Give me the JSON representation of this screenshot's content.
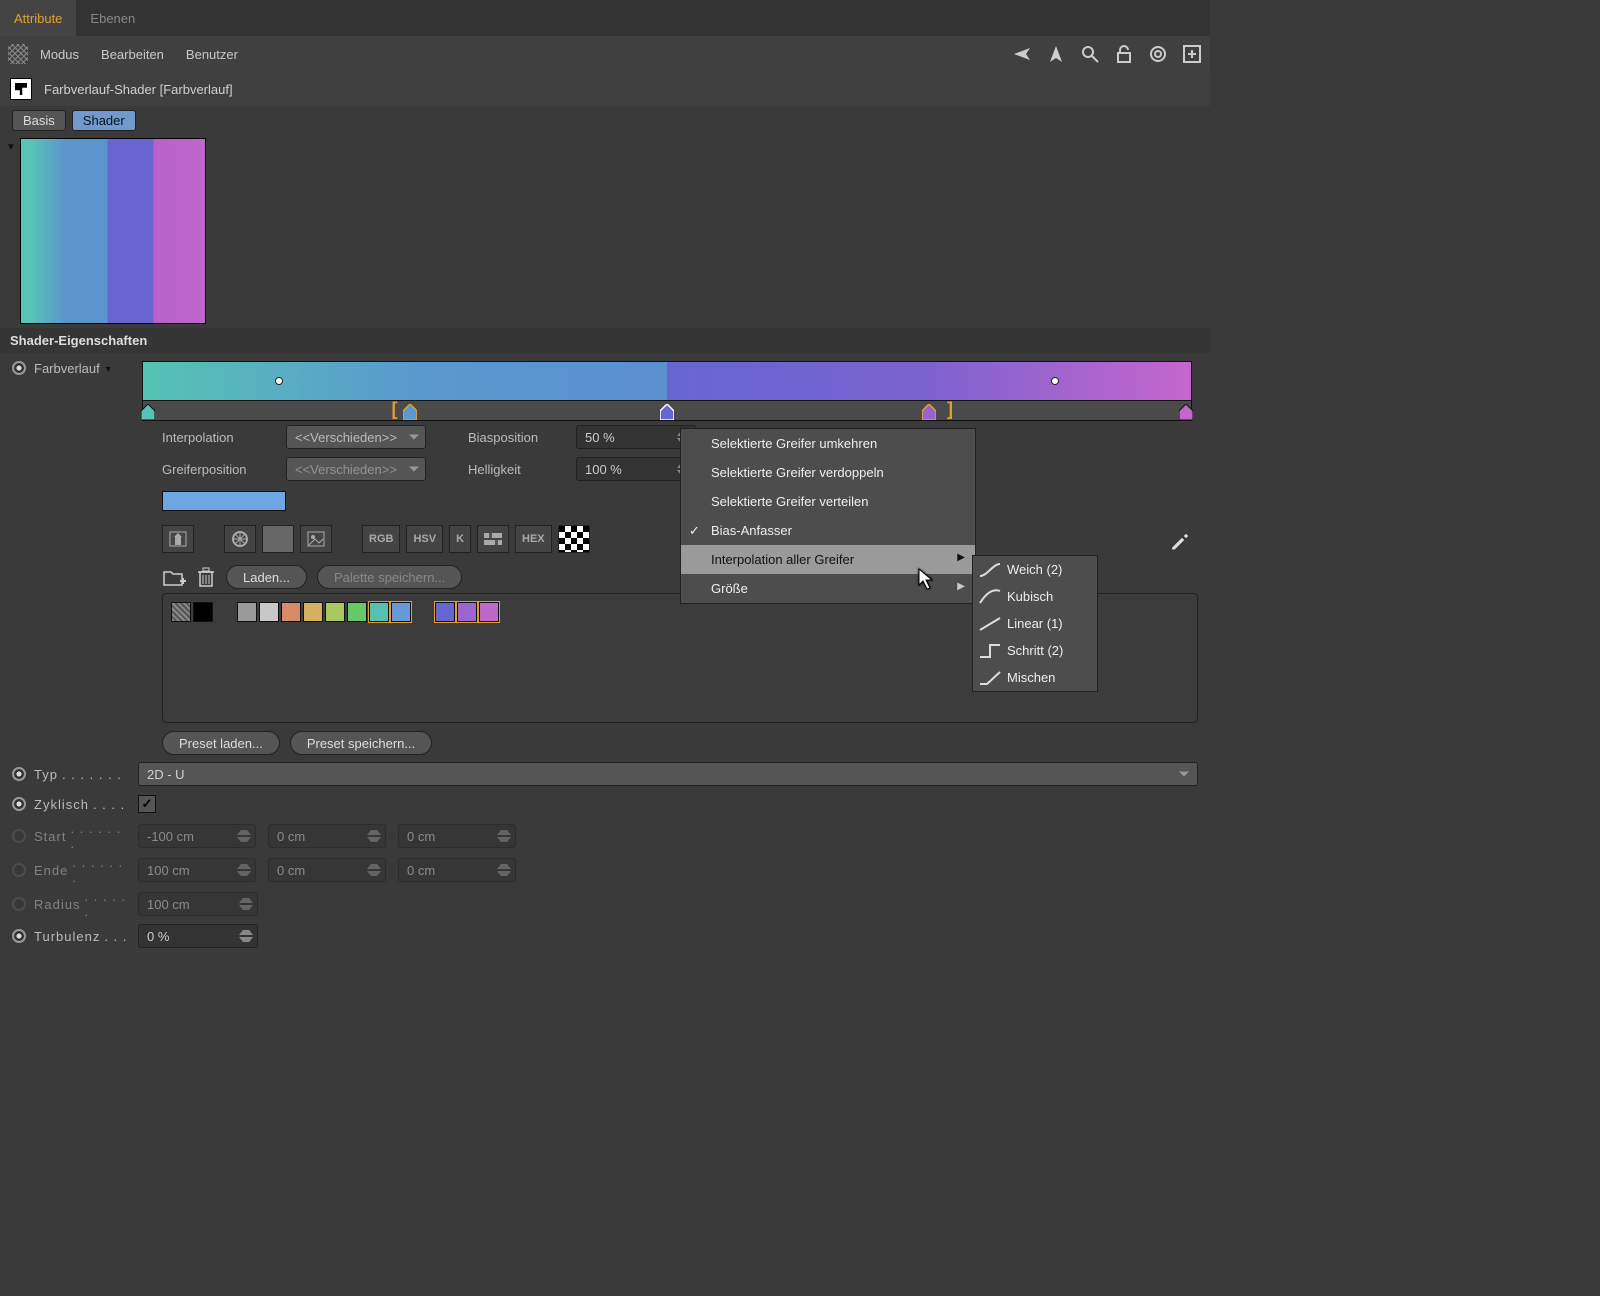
{
  "topTabs": {
    "attribute": "Attribute",
    "ebenen": "Ebenen"
  },
  "menuBar": {
    "modus": "Modus",
    "bearbeiten": "Bearbeiten",
    "benutzer": "Benutzer"
  },
  "title": "Farbverlauf-Shader [Farbverlauf]",
  "subTabs": {
    "basis": "Basis",
    "shader": "Shader"
  },
  "sectionHead": "Shader-Eigenschaften",
  "gradientLabel": "Farbverlauf",
  "interp": {
    "label": "Interpolation",
    "value": "<<Verschieden>>"
  },
  "handlePos": {
    "label": "Greiferposition",
    "value": "<<Verschieden>>"
  },
  "biasPos": {
    "label": "Biasposition",
    "value": "50 %"
  },
  "brightness": {
    "label": "Helligkeit",
    "value": "100 %"
  },
  "iconLabels": {
    "rgb": "RGB",
    "hsv": "HSV",
    "k": "K",
    "hex": "HEX"
  },
  "loadBtn": "Laden...",
  "savePaletteBtn": "Palette speichern...",
  "presetLoad": "Preset laden...",
  "presetSave": "Preset speichern...",
  "typ": {
    "label": "Typ",
    "value": "2D - U"
  },
  "zyklisch": {
    "label": "Zyklisch",
    "value": true
  },
  "start": {
    "label": "Start",
    "x": "-100 cm",
    "y": "0 cm",
    "z": "0 cm"
  },
  "ende": {
    "label": "Ende",
    "x": "100 cm",
    "y": "0 cm",
    "z": "0 cm"
  },
  "radius": {
    "label": "Radius",
    "value": "100 cm"
  },
  "turbulenz": {
    "label": "Turbulenz",
    "value": "0 %"
  },
  "contextMenu": {
    "invert": "Selektierte Greifer umkehren",
    "double": "Selektierte Greifer verdoppeln",
    "distribute": "Selektierte Greifer verteilen",
    "biasHandle": "Bias-Anfasser",
    "interpAll": "Interpolation aller Greifer",
    "size": "Größe"
  },
  "subMenu": {
    "weich": "Weich (2)",
    "kubisch": "Kubisch",
    "linear": "Linear (1)",
    "schritt": "Schritt (2)",
    "mischen": "Mischen"
  },
  "swatchColors": [
    "#000000",
    "#ffffff",
    "#9a9a9a",
    "#c8c8c8",
    "#d98a6a",
    "#d4b060",
    "#a8c860",
    "#68c868",
    "#58c0b0",
    "#6898d8",
    "#6666d0",
    "#9a66d0",
    "#c068c8"
  ],
  "knotColors": [
    "#55c3b5",
    "#5a99ce",
    "#6566d2",
    "#c566cd",
    "#c566cd"
  ]
}
